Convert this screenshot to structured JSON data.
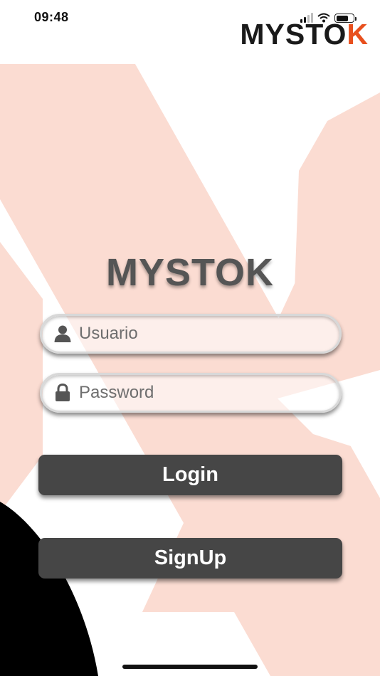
{
  "status_bar": {
    "time": "09:48"
  },
  "header": {
    "logo_main": "MYSTO",
    "logo_accent": "K"
  },
  "main": {
    "title": "MYSTOK",
    "username_placeholder": "Usuario",
    "password_placeholder": "Password",
    "login_label": "Login",
    "signup_label": "SignUp"
  },
  "icons": {
    "user": "user-icon",
    "lock": "lock-icon"
  },
  "colors": {
    "accent": "#e8501e",
    "background_k": "#f9d9cf",
    "button": "#464646",
    "title": "#555555"
  }
}
